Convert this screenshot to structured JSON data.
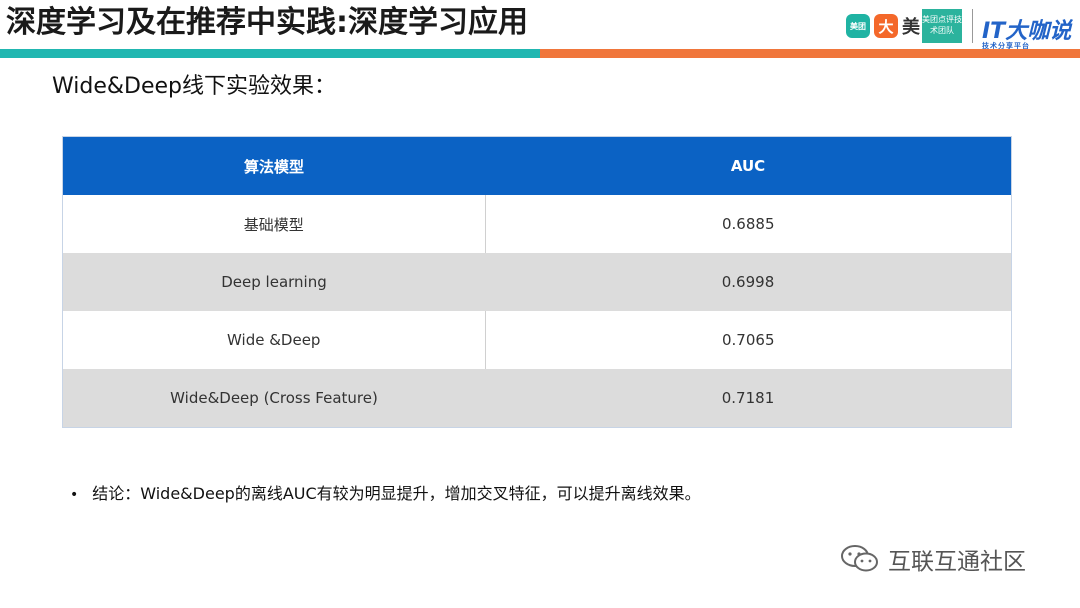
{
  "header": {
    "title": "深度学习及在推荐中实践:深度学习应用",
    "bar_colors": {
      "left": "#21b7b1",
      "right": "#f0763b"
    },
    "logos": {
      "meituan": "美团",
      "dianping": "大",
      "mei": "美",
      "team": "美团点评技术团队",
      "it": "IT大咖说",
      "it_sub": "技术分享平台"
    }
  },
  "subtitle": "Wide&Deep线下实验效果：",
  "table": {
    "columns": [
      "算法模型",
      "AUC"
    ],
    "rows": [
      [
        "基础模型",
        "0.6885"
      ],
      [
        "Deep learning",
        "0.6998"
      ],
      [
        "Wide &Deep",
        "0.7065"
      ],
      [
        "Wide&Deep (Cross Feature)",
        "0.7181"
      ]
    ],
    "header_color": "#0b62c4",
    "stripe_color": "#dcdcdc"
  },
  "conclusion": "结论：Wide&Deep的离线AUC有较为明显提升，增加交叉特征，可以提升离线效果。",
  "watermark": "互联互通社区",
  "icons": {
    "watermark_icon": "wechat-icon"
  }
}
